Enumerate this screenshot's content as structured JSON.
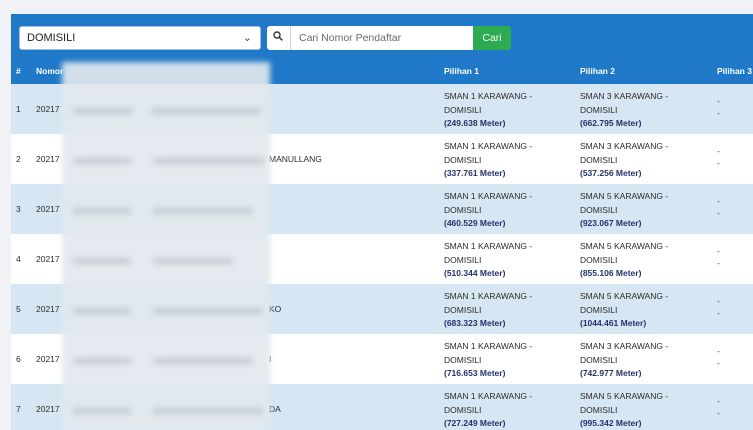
{
  "filter": {
    "selected": "DOMISILI"
  },
  "search": {
    "placeholder": "Cari Nomor Pendaftar",
    "button_label": "Cari"
  },
  "table": {
    "headers": {
      "index": "#",
      "nomor": "Nomor",
      "pilihan1": "Pilihan 1",
      "pilihan2": "Pilihan 2",
      "pilihan3": "Pilihan 3"
    },
    "rows": [
      {
        "index": "1",
        "nomor": "20217",
        "name_suffix": "",
        "pilihan1": {
          "school": "SMAN 1 KARAWANG -",
          "jalur": "DOMISILI",
          "distance": "(249.638 Meter)"
        },
        "pilihan2": {
          "school": "SMAN 3 KARAWANG -",
          "jalur": "DOMISILI",
          "distance": "(662.795 Meter)"
        },
        "pilihan3": {
          "line1": "-",
          "line2": "-"
        }
      },
      {
        "index": "2",
        "nomor": "20217",
        "name_suffix": "MANULLANG",
        "pilihan1": {
          "school": "SMAN 1 KARAWANG -",
          "jalur": "DOMISILI",
          "distance": "(337.761 Meter)"
        },
        "pilihan2": {
          "school": "SMAN 3 KARAWANG -",
          "jalur": "DOMISILI",
          "distance": "(537.256 Meter)"
        },
        "pilihan3": {
          "line1": "-",
          "line2": "-"
        }
      },
      {
        "index": "3",
        "nomor": "20217",
        "name_suffix": "",
        "pilihan1": {
          "school": "SMAN 1 KARAWANG -",
          "jalur": "DOMISILI",
          "distance": "(460.529 Meter)"
        },
        "pilihan2": {
          "school": "SMAN 5 KARAWANG -",
          "jalur": "DOMISILI",
          "distance": "(923.067 Meter)"
        },
        "pilihan3": {
          "line1": "-",
          "line2": "-"
        }
      },
      {
        "index": "4",
        "nomor": "20217",
        "name_suffix": "",
        "pilihan1": {
          "school": "SMAN 1 KARAWANG -",
          "jalur": "DOMISILI",
          "distance": "(510.344 Meter)"
        },
        "pilihan2": {
          "school": "SMAN 5 KARAWANG -",
          "jalur": "DOMISILI",
          "distance": "(855.106 Meter)"
        },
        "pilihan3": {
          "line1": "-",
          "line2": "-"
        }
      },
      {
        "index": "5",
        "nomor": "20217",
        "name_suffix": "KO",
        "pilihan1": {
          "school": "SMAN 1 KARAWANG -",
          "jalur": "DOMISILI",
          "distance": "(683.323 Meter)"
        },
        "pilihan2": {
          "school": "SMAN 5 KARAWANG -",
          "jalur": "DOMISILI",
          "distance": "(1044.461 Meter)"
        },
        "pilihan3": {
          "line1": "-",
          "line2": "-"
        }
      },
      {
        "index": "6",
        "nomor": "20217",
        "name_suffix": "I",
        "pilihan1": {
          "school": "SMAN 1 KARAWANG -",
          "jalur": "DOMISILI",
          "distance": "(716.653 Meter)"
        },
        "pilihan2": {
          "school": "SMAN 3 KARAWANG -",
          "jalur": "DOMISILI",
          "distance": "(742.977 Meter)"
        },
        "pilihan3": {
          "line1": "-",
          "line2": "-"
        }
      },
      {
        "index": "7",
        "nomor": "20217",
        "name_suffix": "DA",
        "pilihan1": {
          "school": "SMAN 1 KARAWANG -",
          "jalur": "DOMISILI",
          "distance": "(727.249 Meter)"
        },
        "pilihan2": {
          "school": "SMAN 5 KARAWANG -",
          "jalur": "DOMISILI",
          "distance": "(995.342 Meter)"
        },
        "pilihan3": {
          "line1": "-",
          "line2": "-"
        }
      }
    ]
  },
  "colors": {
    "header_blue": "#1f78c8",
    "button_green": "#2eaa50",
    "row_alt": "#d6e7f3",
    "distance_text": "#25316a"
  },
  "icons": {
    "search": "search-icon",
    "dropdown": "chevron-down-icon"
  }
}
